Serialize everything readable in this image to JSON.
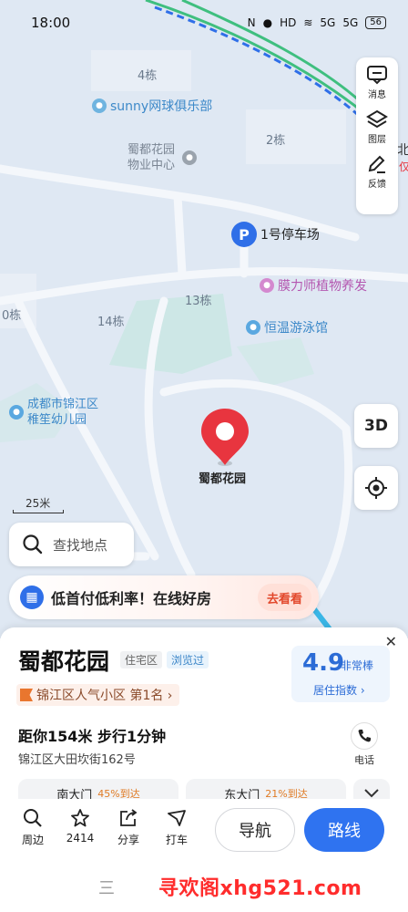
{
  "status_bar": {
    "time": "18:00",
    "indicators": [
      "N",
      "HD",
      "5G",
      "5G"
    ],
    "battery": "56"
  },
  "map": {
    "labels": {
      "bldg_4": "4栋",
      "bldg_2": "2栋",
      "bldg_13": "13栋",
      "bldg_14": "14栋",
      "bldg_10_partial": "0栋"
    },
    "pois": {
      "tennis": "sunny网球俱乐部",
      "property_line1": "蜀都花园",
      "property_line2": "物业中心",
      "parking": "1号停车场",
      "plant": "膜力师植物养发",
      "pool": "恒温游泳馆",
      "kinder_line1": "成都市锦江区",
      "kinder_line2": "稚笙幼儿园"
    },
    "edge_text_right": "北",
    "edge_text_right2": "仅",
    "pin_label": "蜀都花园",
    "scale": "25米",
    "colors": {
      "route_green": "#3fbf7f",
      "route_blue": "#2f6fe8",
      "pin_red": "#e8353f"
    }
  },
  "right_panel": {
    "message": "消息",
    "layers": "图层",
    "feedback": "反馈",
    "btn_3d": "3D"
  },
  "search": {
    "placeholder": "查找地点"
  },
  "ad": {
    "text": "低首付低利率！在线好房",
    "button": "去看看"
  },
  "sheet": {
    "title": "蜀都花园",
    "type_tag": "住宅区",
    "viewed_tag": "浏览过",
    "rank": "锦江区人气小区 第1名 ›",
    "score": "4.9",
    "score_word": "非常棒",
    "score_index": "居住指数 ›",
    "distance": "距你154米  步行1分钟",
    "address": "锦江区大田坎街162号",
    "phone_label": "电话",
    "gates": [
      {
        "name": "南大门",
        "pct": "45%到达"
      },
      {
        "name": "东大门",
        "pct": "21%到达"
      }
    ]
  },
  "toolbar": {
    "nearby": "周边",
    "favorites": "2414",
    "share": "分享",
    "taxi": "打车",
    "navigate": "导航",
    "route": "路线"
  },
  "system_nav": {
    "menu_icon": "三",
    "watermark": "寻欢阁xhg521.com"
  }
}
